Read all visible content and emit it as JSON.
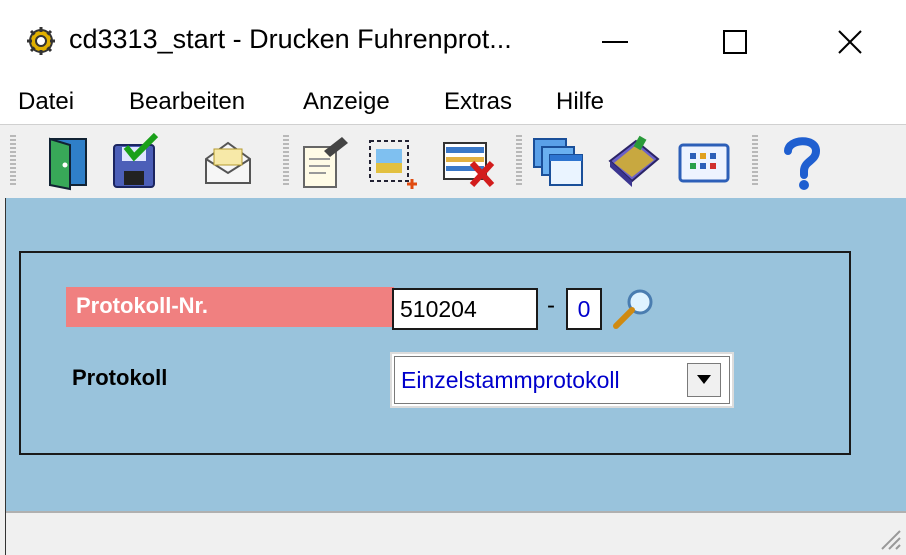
{
  "window": {
    "title": "cd3313_start  - Drucken Fuhrenprot...",
    "title_icon": "gear-icon"
  },
  "menu": {
    "items": [
      {
        "label": "Datei"
      },
      {
        "label": "Bearbeiten"
      },
      {
        "label": "Anzeige"
      },
      {
        "label": "Extras"
      },
      {
        "label": "Hilfe"
      }
    ]
  },
  "toolbar": {
    "icons": [
      "exit-door-icon",
      "save-icon",
      "mail-icon",
      "edit-document-icon",
      "new-record-icon",
      "delete-record-icon",
      "windows-icon",
      "book-icon",
      "grid-view-icon",
      "help-icon"
    ]
  },
  "form": {
    "protokoll_nr_label": "Protokoll-Nr.",
    "protokoll_nr_value": "510204",
    "separator": "-",
    "protokoll_sub_value": "0",
    "protokoll_label": "Protokoll",
    "protokoll_selected": "Einzelstammprotokoll"
  },
  "colors": {
    "client_background": "#99c3dc",
    "required_label_background": "#f08080",
    "value_text": "#0000cc"
  }
}
